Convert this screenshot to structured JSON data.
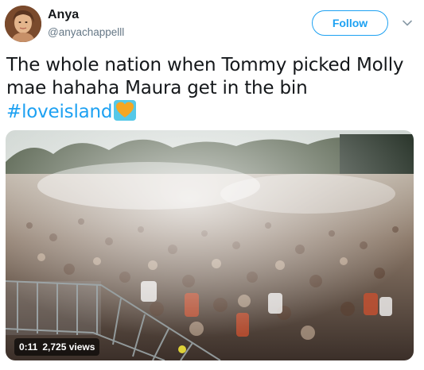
{
  "user": {
    "name": "Anya",
    "handle": "@anyachappelll"
  },
  "follow_button": {
    "label": "Follow"
  },
  "tweet": {
    "text_part1": "The whole nation when Tommy picked Molly mae hahaha Maura get in the bin",
    "hashtag": "#loveisland"
  },
  "video": {
    "duration": "0:11",
    "views": "2,725 views"
  },
  "colors": {
    "accent": "#1da1f2",
    "text": "#14171a",
    "secondary": "#657786"
  },
  "icons": {
    "menu": "chevron-down-icon",
    "emoji": "heart-emoji-icon"
  }
}
